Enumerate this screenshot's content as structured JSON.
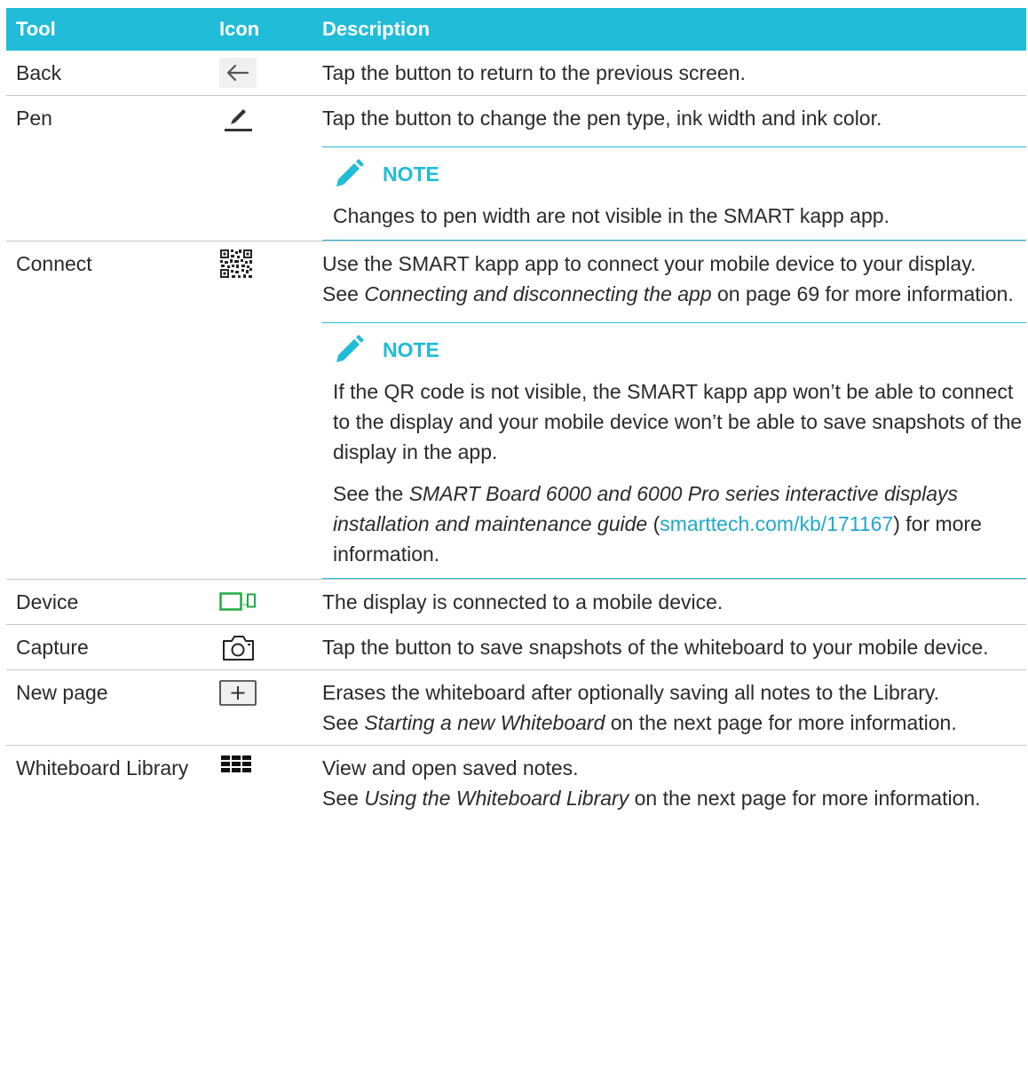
{
  "header": {
    "tool": "Tool",
    "icon": "Icon",
    "description": "Description"
  },
  "colors": {
    "accent": "#21bcd8",
    "link": "#21a8c8",
    "device_green": "#22aa44"
  },
  "rows": [
    {
      "tool": "Back",
      "icon": "back-arrow-icon",
      "description": [
        "Tap the button to return to the previous screen."
      ]
    },
    {
      "tool": "Pen",
      "icon": "pen-icon",
      "description": [
        "Tap the button to change the pen type, ink width and ink color."
      ],
      "note": {
        "title": "NOTE",
        "paragraphs": [
          "Changes to pen width are not visible in the SMART kapp app."
        ]
      }
    },
    {
      "tool": "Connect",
      "icon": "qr-code-icon",
      "description": [
        "Use the SMART kapp app to connect your mobile device to your display.",
        {
          "before": "See ",
          "italic": "Connecting and disconnecting the app",
          "after": " on page 69 for more information."
        }
      ],
      "note": {
        "title": "NOTE",
        "p1": "If the QR code is not visible, the SMART kapp app won’t be able to connect to the display and your mobile device won’t be able to save snapshots of the display in the app.",
        "p2_before": "See the ",
        "p2_italic": "SMART Board 6000 and 6000 Pro series interactive displays installation and maintenance guide",
        "p2_open": " (",
        "p2_link": "smarttech.com/kb/171167",
        "p2_after": ") for more information."
      }
    },
    {
      "tool": "Device",
      "icon": "device-connected-icon",
      "description": [
        "The display is connected to a mobile device."
      ]
    },
    {
      "tool": "Capture",
      "icon": "camera-icon",
      "description": [
        "Tap the button to save snapshots of the whiteboard to your mobile device."
      ]
    },
    {
      "tool": "New page",
      "icon": "new-page-icon",
      "description": [
        "Erases the whiteboard after optionally saving all notes to the Library.",
        {
          "before": "See ",
          "italic": "Starting a new Whiteboard",
          "after": " on the next page for more information."
        }
      ]
    },
    {
      "tool": "Whiteboard Library",
      "icon": "grid-icon",
      "description": [
        "View and open saved notes.",
        {
          "before": "See ",
          "italic": "Using the Whiteboard Library",
          "after": " on the next page for more information."
        }
      ]
    }
  ]
}
